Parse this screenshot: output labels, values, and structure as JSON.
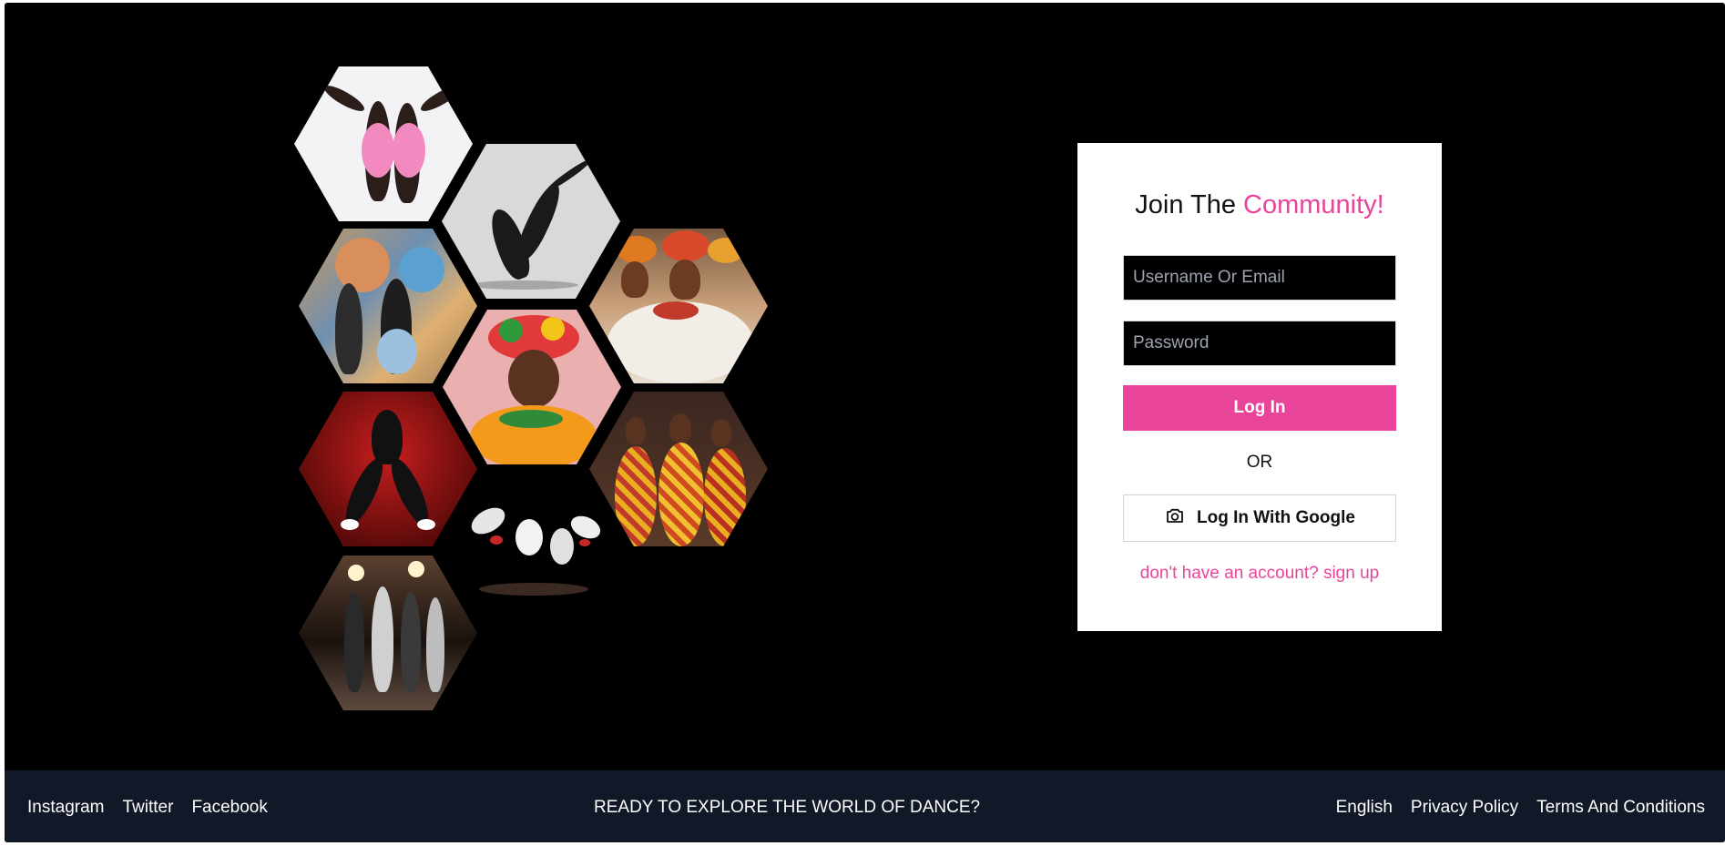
{
  "login": {
    "title_prefix": "Join The",
    "title_accent": "Community!",
    "username_placeholder": "Username Or Email",
    "password_placeholder": "Password",
    "login_button": "Log In",
    "or_text": "OR",
    "google_button": "Log In With Google",
    "google_icon": "camera-icon",
    "signup_link": "don't have an account? sign up"
  },
  "footer": {
    "social": [
      "Instagram",
      "Twitter",
      "Facebook"
    ],
    "tagline": "READY TO EXPLORE THE WORLD OF DANCE?",
    "links": [
      "English",
      "Privacy Policy",
      "Terms And Conditions"
    ]
  },
  "colors": {
    "accent": "#e8459a",
    "background": "#000000",
    "footer": "#111827",
    "card": "#ffffff"
  },
  "collage": {
    "images": [
      "dancers-pink-outfits",
      "ballet-duo",
      "street-dancers-mural",
      "traditional-dancers-headwraps",
      "dancer-flower-headdress",
      "dancer-red-background",
      "dancers-patterned-dresses",
      "acrobatic-dancers-stage",
      "dance-group-stage"
    ]
  }
}
